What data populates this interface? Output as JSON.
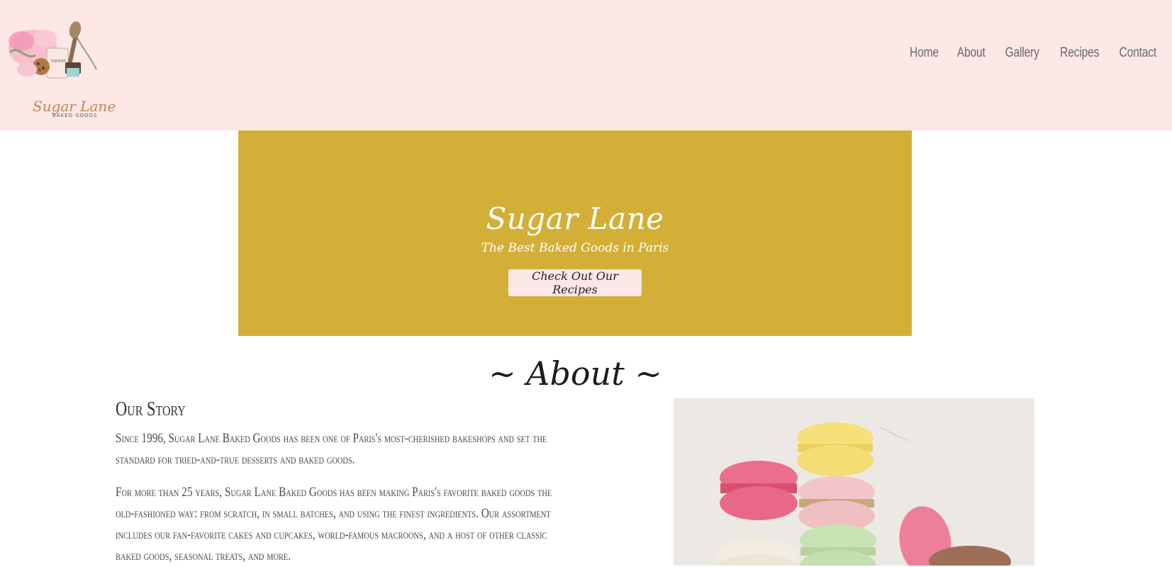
{
  "header": {
    "logo": {
      "name": "Sugar Lane",
      "tagline": "BAKED GOODS"
    },
    "nav": [
      {
        "label": "Home"
      },
      {
        "label": "About"
      },
      {
        "label": "Gallery"
      },
      {
        "label": "Recipes"
      },
      {
        "label": "Contact"
      }
    ],
    "background_color": "#fde7e7"
  },
  "hero": {
    "title": "Sugar Lane",
    "subtitle": "The Best Baked Goods in Paris",
    "button_label": "Check Out Our Recipes",
    "background_color": "#d4af37"
  },
  "about": {
    "heading": "~ About ~",
    "story_heading": "Our Story",
    "paragraphs": [
      "Since 1996, Sugar Lane Baked Goods has been one of Paris's most-cherished bakeshops and set the standard for tried-and-true desserts and baked goods.",
      "For more than 25 years, Sugar Lane Baked Goods has been making Paris's favorite baked goods the old-fashioned way: from scratch, in small batches, and using the finest ingredients. Our assortment includes our fan-favorite cakes and cupcakes, world-famous macroons, and a host of other classic baked goods, seasonal treats, and more."
    ],
    "image": {
      "subject": "macarons-photo"
    }
  }
}
